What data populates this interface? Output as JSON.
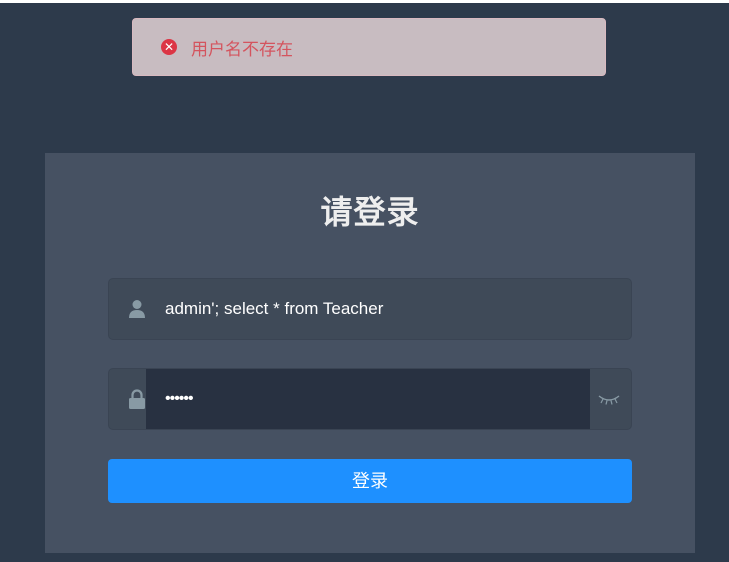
{
  "alert": {
    "icon": "close-circle-icon",
    "message": "用户名不存在",
    "color": "#d4545e"
  },
  "login": {
    "title": "请登录",
    "username": {
      "icon": "user-icon",
      "value": "admin'; select * from Teacher"
    },
    "password": {
      "icon": "lock-icon",
      "value": "••••••",
      "toggle_icon": "eye-closed-icon"
    },
    "submit_label": "登录",
    "accent_color": "#1e90ff"
  }
}
